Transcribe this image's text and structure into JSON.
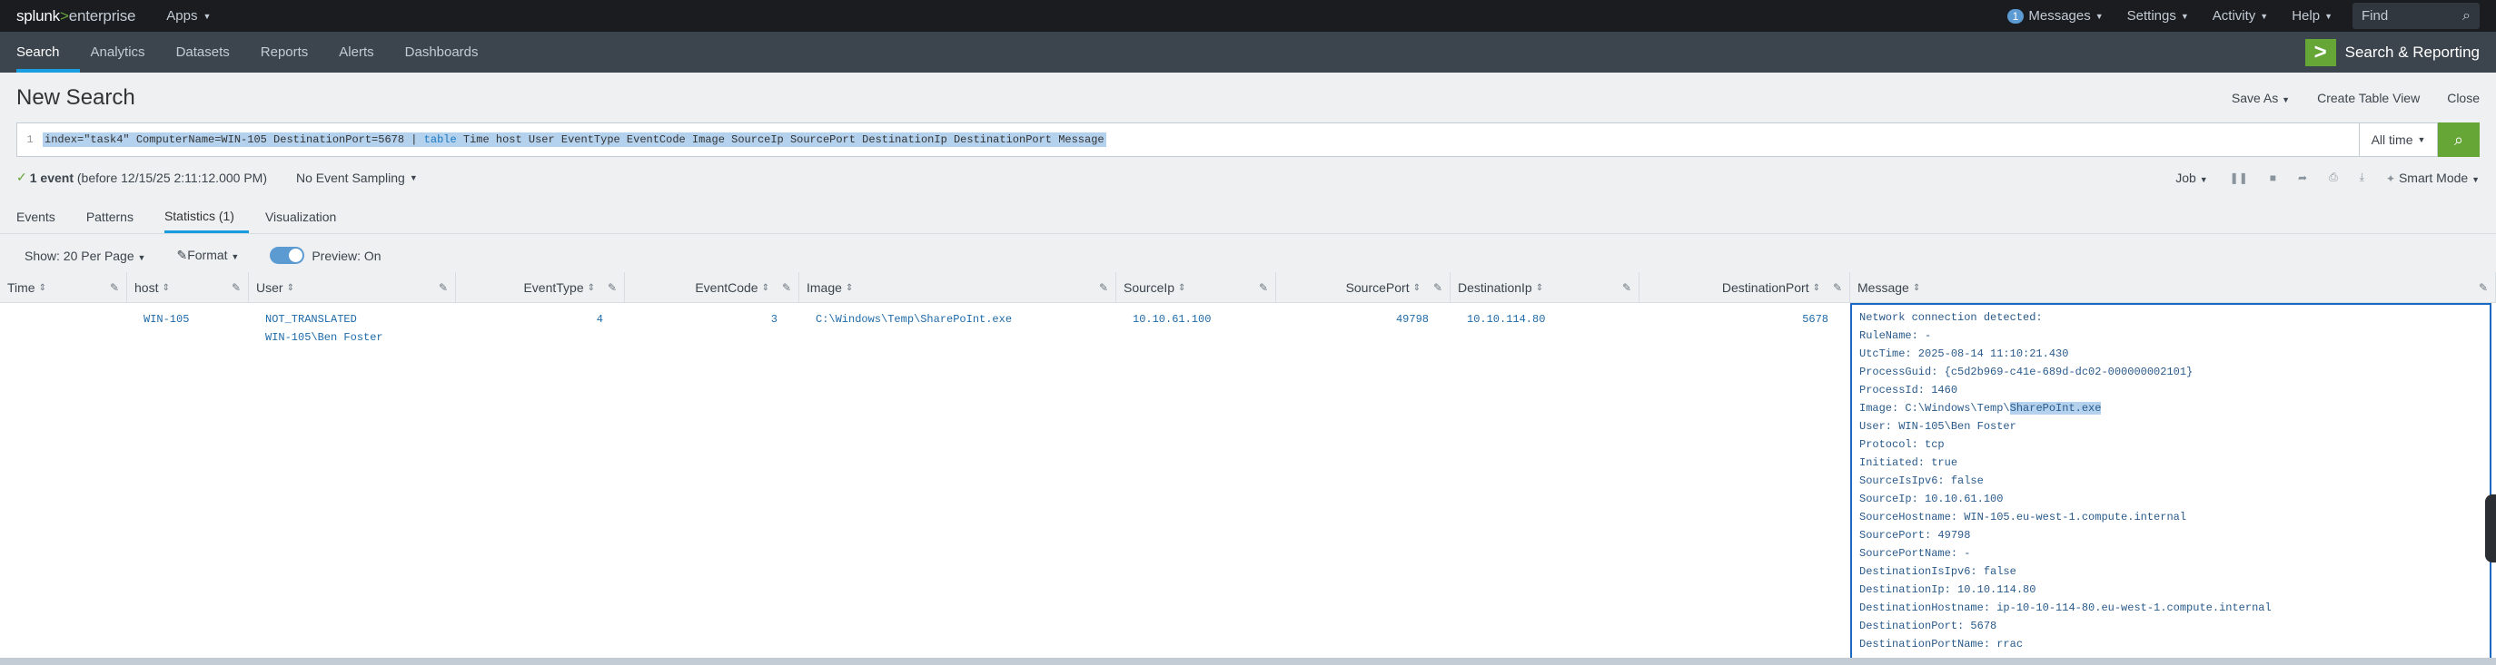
{
  "topbar": {
    "logo_main": "splunk",
    "logo_sep": ">",
    "logo_sub": "enterprise",
    "apps": "Apps",
    "messages_count": "1",
    "messages": "Messages",
    "settings": "Settings",
    "activity": "Activity",
    "help": "Help",
    "find_placeholder": "Find"
  },
  "appbar": {
    "nav": [
      "Search",
      "Analytics",
      "Datasets",
      "Reports",
      "Alerts",
      "Dashboards"
    ],
    "app_name": "Search & Reporting"
  },
  "header": {
    "title": "New Search",
    "save_as": "Save As",
    "create_table_view": "Create Table View",
    "close": "Close"
  },
  "search": {
    "line": "1",
    "query_part1": "index=\"task4\" ComputerName=WIN-105 DestinationPort=5678 | ",
    "query_kw": "table",
    "query_part2": " Time host User EventType EventCode Image SourceIp SourcePort DestinationIp DestinationPort Message",
    "time_range": "All time"
  },
  "status": {
    "events": "1 event",
    "before": "(before 12/15/25 2:11:12.000 PM)",
    "sampling": "No Event Sampling",
    "job": "Job",
    "mode": "Smart Mode"
  },
  "tabs": [
    "Events",
    "Patterns",
    "Statistics (1)",
    "Visualization"
  ],
  "toolbar": {
    "per_page": "Show: 20 Per Page",
    "format": "Format",
    "preview": "Preview: On"
  },
  "table": {
    "columns": [
      "Time",
      "host",
      "User",
      "EventType",
      "EventCode",
      "Image",
      "SourceIp",
      "SourcePort",
      "DestinationIp",
      "DestinationPort",
      "Message"
    ],
    "row": {
      "time": "",
      "host": "WIN-105",
      "user1": "NOT_TRANSLATED",
      "user2": "WIN-105\\Ben Foster",
      "eventtype": "4",
      "eventcode": "3",
      "image": "C:\\Windows\\Temp\\SharePoInt.exe",
      "sourceip": "10.10.61.100",
      "sourceport": "49798",
      "destip": "10.10.114.80",
      "destport": "5678"
    },
    "message_lines": [
      "Network connection detected:",
      "RuleName: -",
      "UtcTime: 2025-08-14 11:10:21.430",
      "ProcessGuid: {c5d2b969-c41e-689d-dc02-000000002101}",
      "ProcessId: 1460",
      "Image: C:\\Windows\\Temp\\",
      "User: WIN-105\\Ben Foster",
      "Protocol: tcp",
      "Initiated: true",
      "SourceIsIpv6: false",
      "SourceIp: 10.10.61.100",
      "SourceHostname: WIN-105.eu-west-1.compute.internal",
      "SourcePort: 49798",
      "SourcePortName: -",
      "DestinationIsIpv6: false",
      "DestinationIp: 10.10.114.80",
      "DestinationHostname: ip-10-10-114-80.eu-west-1.compute.internal",
      "DestinationPort: 5678",
      "DestinationPortName: rrac"
    ],
    "message_highlight": "SharePoInt.exe"
  }
}
